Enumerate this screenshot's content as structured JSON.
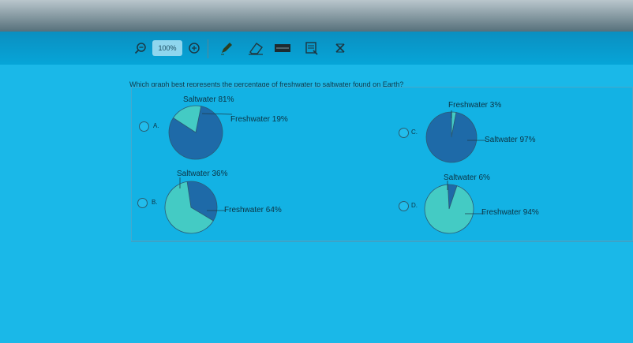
{
  "toolbar": {
    "zoom_level": "100%",
    "icons": [
      "zoom-out-icon",
      "zoom-in-icon",
      "pen-icon",
      "eraser-icon",
      "ruler-icon",
      "notes-icon",
      "close-icon"
    ]
  },
  "question": {
    "before": "Which graph ",
    "emphasis": "best",
    "after": " represents the percentage of freshwater to saltwater found on Earth?"
  },
  "options": [
    {
      "letter": "A.",
      "top_label": "Saltwater 81%",
      "side_label": "Freshwater 19%"
    },
    {
      "letter": "C.",
      "top_label": "Freshwater 3%",
      "side_label": "Saltwater 97%"
    },
    {
      "letter": "B.",
      "top_label": "Saltwater 36%",
      "side_label": "Freshwater 64%"
    },
    {
      "letter": "D.",
      "top_label": "Saltwater 6%",
      "side_label": "Freshwater 94%"
    }
  ],
  "chart_data": [
    {
      "type": "pie",
      "categories": [
        "Saltwater",
        "Freshwater"
      ],
      "values": [
        81,
        19
      ]
    },
    {
      "type": "pie",
      "categories": [
        "Freshwater",
        "Saltwater"
      ],
      "values": [
        3,
        97
      ]
    },
    {
      "type": "pie",
      "categories": [
        "Saltwater",
        "Freshwater"
      ],
      "values": [
        36,
        64
      ]
    },
    {
      "type": "pie",
      "categories": [
        "Saltwater",
        "Freshwater"
      ],
      "values": [
        6,
        94
      ]
    }
  ],
  "colors": {
    "dark_slice": "#1e6aa8",
    "light_slice": "#44cbc4"
  }
}
